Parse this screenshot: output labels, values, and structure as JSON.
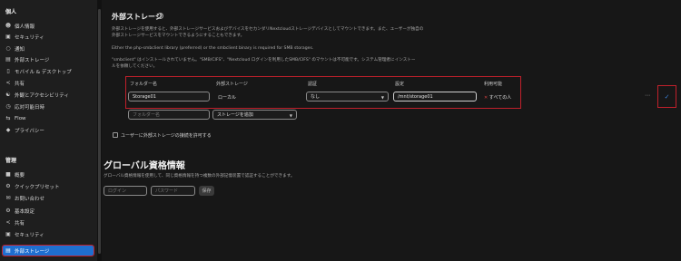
{
  "sidebar": {
    "personal_heading": "個人",
    "admin_heading": "管理",
    "personal_items": [
      {
        "label": "個人情報",
        "icon": "user-icon"
      },
      {
        "label": "セキュリティ",
        "icon": "lock-icon"
      },
      {
        "label": "通知",
        "icon": "bell-icon"
      },
      {
        "label": "外部ストレージ",
        "icon": "storage-icon"
      },
      {
        "label": "モバイル & デスクトップ",
        "icon": "mobile-icon"
      },
      {
        "label": "共有",
        "icon": "share-icon"
      },
      {
        "label": "外観とアクセシビリティ",
        "icon": "accessibility-icon"
      },
      {
        "label": "応対可能日時",
        "icon": "clock-icon"
      },
      {
        "label": "Flow",
        "icon": "flow-icon"
      },
      {
        "label": "プライバシー",
        "icon": "privacy-icon"
      }
    ],
    "admin_items": [
      {
        "label": "概要",
        "icon": "overview-icon"
      },
      {
        "label": "クイックプリセット",
        "icon": "preset-icon"
      },
      {
        "label": "お問い合わせ",
        "icon": "contact-icon"
      },
      {
        "label": "基本設定",
        "icon": "settings-icon"
      },
      {
        "label": "共有",
        "icon": "share-icon"
      },
      {
        "label": "セキュリティ",
        "icon": "lock-icon"
      },
      {
        "label": "外部ストレージ",
        "icon": "storage-icon"
      }
    ]
  },
  "external_storage": {
    "title": "外部ストレージ",
    "desc_line1": "外部ストレージを使用すると、外部ストレージサービスおよびデバイスをセカンダリNextcloudストレージデバイスとしてマウントできます。また、ユーザーが独自の",
    "desc_line2": "外部ストレージサービスをマウントできるようにすることもできます。",
    "smb_note": "Either the php-smbclient library (preferred) or the smbclient binary is required for SMB storages.",
    "warn_line1": "\"smbclient\" はインストールされていません。\"SMB/CIFS\"、\"Nextcloud ログインを利用したSMB/CIFS\" のマウントは不可能です。システム管理者にインストー",
    "warn_line2": "ルを依頼してください。",
    "table_headers": {
      "folder": "フォルダー名",
      "storage": "外部ストレージ",
      "auth": "認証",
      "config": "設定",
      "available": "利用可能"
    },
    "row": {
      "folder": "Storage01",
      "storage": "ローカル",
      "auth": "なし",
      "config": "/mnt/storage01",
      "available": "すべての人"
    },
    "new_folder_placeholder": "フォルダー名",
    "add_storage_label": "ストレージを追加",
    "allow_user_mount": "ユーザーに外部ストレージの接続を許可する"
  },
  "global_credentials": {
    "title": "グローバル資格情報",
    "desc": "グローバル資格情報を使用して、同じ資格情報を持つ複数の外部記憶装置で認証することができます。",
    "login_placeholder": "ログイン",
    "password_placeholder": "パスワード",
    "save_label": "保存"
  },
  "colors": {
    "accent": "#1f6fd0",
    "highlight_red": "#c0202b",
    "check_blue": "#3b86e0"
  }
}
